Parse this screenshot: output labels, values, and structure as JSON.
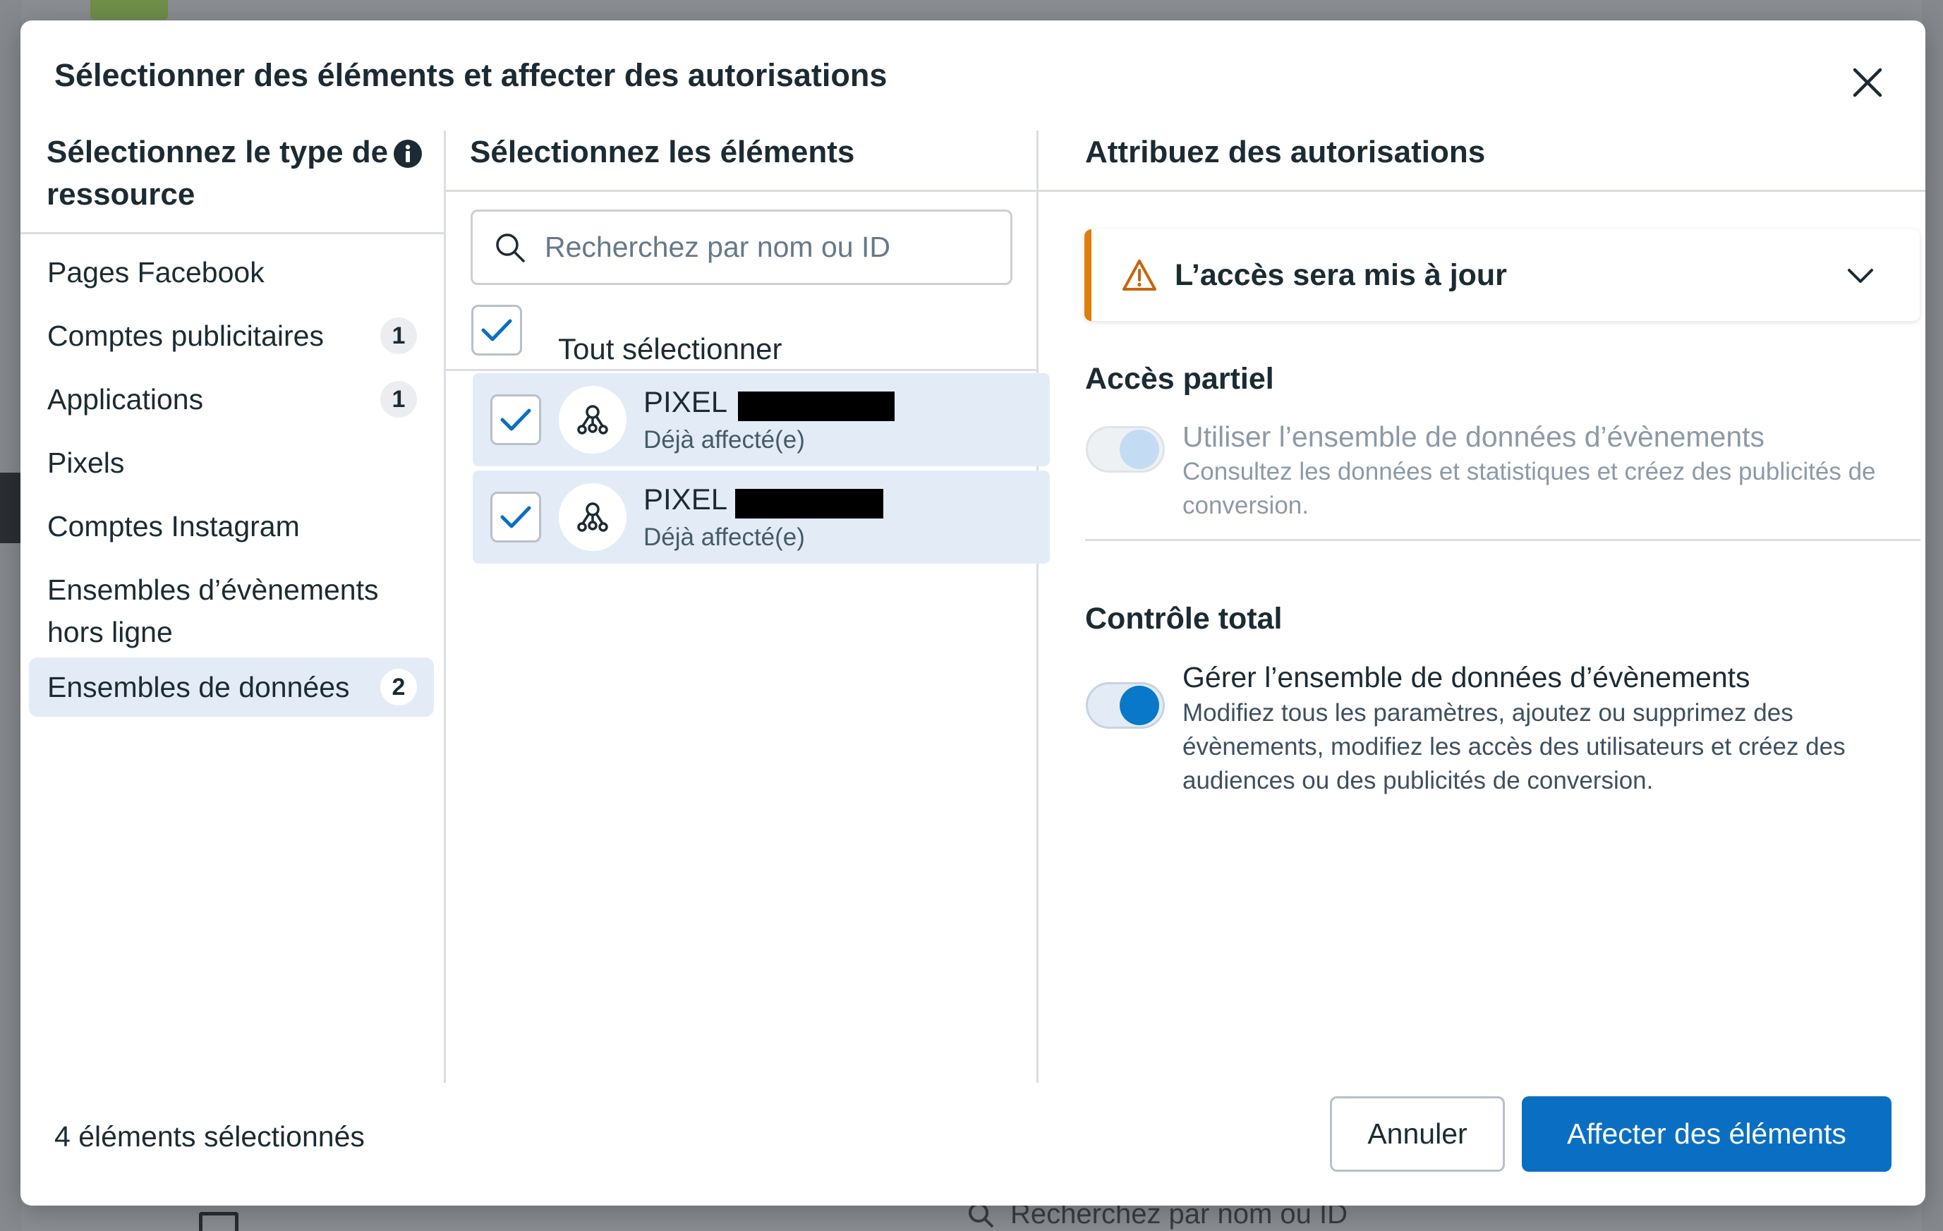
{
  "background": {
    "search_placeholder": "Recherchez par nom ou ID"
  },
  "modal": {
    "title": "Sélectionner des éléments et affecter des autorisations",
    "close_icon": "close-icon"
  },
  "left_column": {
    "header": "Sélectionnez le type de ressource",
    "info_icon": "info-icon",
    "items": [
      {
        "label": "Pages Facebook",
        "count": ""
      },
      {
        "label": "Comptes publicitaires",
        "count": "1"
      },
      {
        "label": "Applications",
        "count": "1"
      },
      {
        "label": "Pixels",
        "count": ""
      },
      {
        "label": "Comptes Instagram",
        "count": ""
      },
      {
        "label": "Ensembles d’évènements hors ligne",
        "count": ""
      },
      {
        "label": "Ensembles de données",
        "count": "2",
        "active": true
      }
    ]
  },
  "middle_column": {
    "header": "Sélectionnez les éléments",
    "search_placeholder": "Recherchez par nom ou ID",
    "select_all_label": "Tout sélectionner",
    "select_all_checked": true,
    "rows": [
      {
        "name": "PIXEL",
        "status": "Déjà affecté(e)",
        "checked": true
      },
      {
        "name": "PIXEL",
        "status": "Déjà affecté(e)",
        "checked": true
      }
    ]
  },
  "right_column": {
    "header": "Attribuez des autorisations",
    "alert": {
      "text": "L’accès sera mis à jour",
      "icon": "warning-icon",
      "color": "#e07e0c"
    },
    "partial": {
      "title": "Accès partiel",
      "label": "Utiliser l’ensemble de données d’évènements",
      "description": "Consultez les données et statistiques et créez des publicités de conversion.",
      "enabled": false
    },
    "full": {
      "title": "Contrôle total",
      "label": "Gérer l’ensemble de données d’évènements",
      "description": "Modifiez tous les paramètres, ajoutez ou supprimez des évènements, modifiez les accès des utilisateurs et créez des audiences ou des publicités de conversion.",
      "enabled": true
    }
  },
  "footer": {
    "selected_count": "4 éléments sélectionnés",
    "cancel_label": "Annuler",
    "submit_label": "Affecter des éléments"
  },
  "colors": {
    "primary": "#0a6fc2",
    "active_bg": "#e3ecf6",
    "warning": "#e07e0c"
  }
}
